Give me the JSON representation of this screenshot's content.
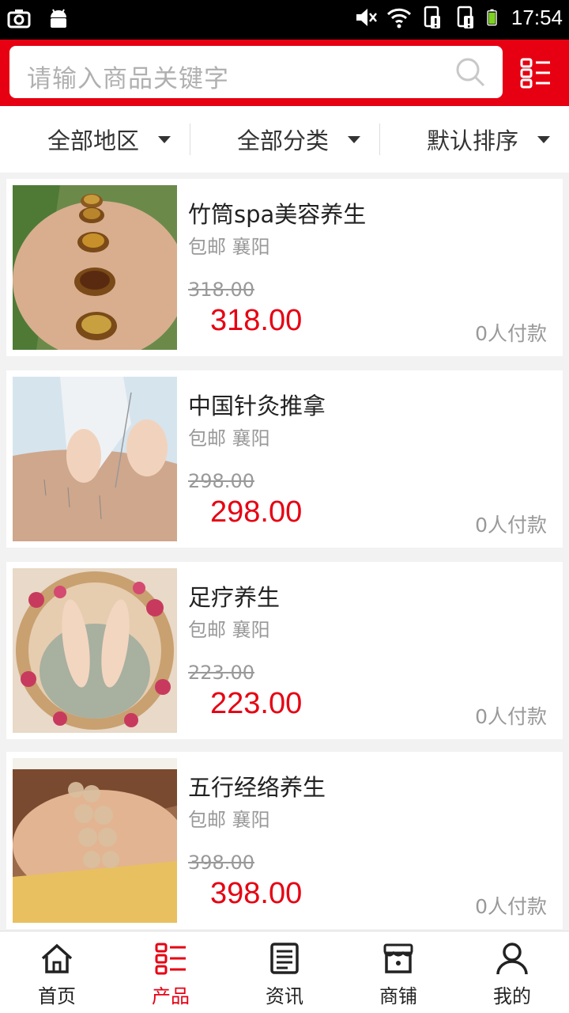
{
  "status_bar": {
    "time": "17:54"
  },
  "search": {
    "placeholder": "请输入商品关键字"
  },
  "filters": [
    {
      "label": "全部地区"
    },
    {
      "label": "全部分类"
    },
    {
      "label": "默认排序"
    }
  ],
  "products": [
    {
      "title": "竹筒spa美容养生",
      "meta": "包邮 襄阳",
      "old_price": "318.00",
      "price": "318.00",
      "paid": "0人付款"
    },
    {
      "title": "中国针灸推拿",
      "meta": "包邮 襄阳",
      "old_price": "298.00",
      "price": "298.00",
      "paid": "0人付款"
    },
    {
      "title": "足疗养生",
      "meta": "包邮 襄阳",
      "old_price": "223.00",
      "price": "223.00",
      "paid": "0人付款"
    },
    {
      "title": "五行经络养生",
      "meta": "包邮 襄阳",
      "old_price": "398.00",
      "price": "398.00",
      "paid": "0人付款"
    }
  ],
  "tabs": [
    {
      "label": "首页",
      "icon": "home-icon"
    },
    {
      "label": "产品",
      "icon": "list-icon",
      "active": true
    },
    {
      "label": "资讯",
      "icon": "news-icon"
    },
    {
      "label": "商铺",
      "icon": "store-icon"
    },
    {
      "label": "我的",
      "icon": "user-icon"
    }
  ],
  "colors": {
    "accent": "#e60012",
    "background": "#f2f2f2"
  }
}
